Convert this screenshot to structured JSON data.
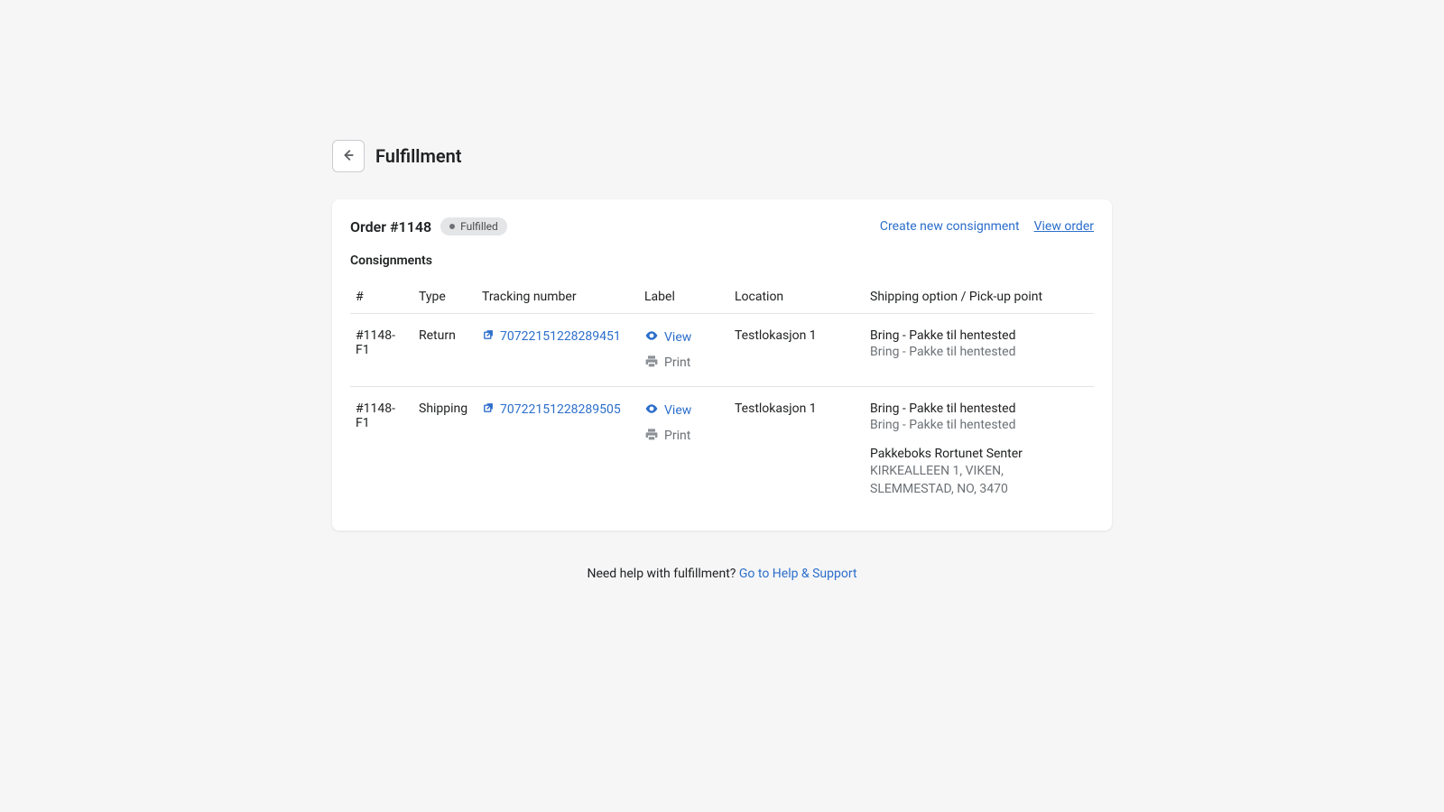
{
  "header": {
    "title": "Fulfillment"
  },
  "card": {
    "order_title": "Order #1148",
    "badge": "Fulfilled",
    "actions": {
      "create": "Create new consignment",
      "view_order": "View order"
    },
    "section_title": "Consignments"
  },
  "table": {
    "headers": {
      "id": "#",
      "type": "Type",
      "tracking": "Tracking number",
      "label": "Label",
      "location": "Location",
      "shipping": "Shipping option / Pick-up point"
    },
    "label_actions": {
      "view": "View",
      "print": "Print"
    },
    "rows": [
      {
        "id": "#1148-F1",
        "type": "Return",
        "tracking": "70722151228289451",
        "location": "Testlokasjon 1",
        "ship_primary": "Bring - Pakke til hentested",
        "ship_secondary": "Bring - Pakke til hentested",
        "pickup_title": "",
        "pickup_address": ""
      },
      {
        "id": "#1148-F1",
        "type": "Shipping",
        "tracking": "70722151228289505",
        "location": "Testlokasjon 1",
        "ship_primary": "Bring - Pakke til hentested",
        "ship_secondary": "Bring - Pakke til hentested",
        "pickup_title": "Pakkeboks Rortunet Senter",
        "pickup_address": "KIRKEALLEEN 1, VIKEN, SLEMMESTAD, NO, 3470"
      }
    ]
  },
  "footer": {
    "prompt": "Need help with fulfillment? ",
    "link": "Go to Help & Support"
  }
}
